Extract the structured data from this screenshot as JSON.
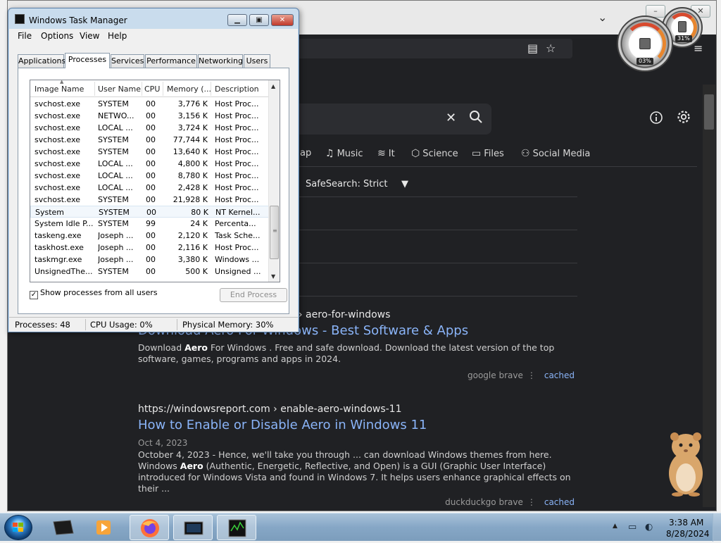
{
  "browser": {
    "search_clear": "✕",
    "categories": [
      {
        "icon": "map-icon",
        "label": "ap"
      },
      {
        "icon": "music-icon",
        "label": "Music"
      },
      {
        "icon": "stack-icon",
        "label": "It"
      },
      {
        "icon": "cube-icon",
        "label": "Science"
      },
      {
        "icon": "files-icon",
        "label": "Files"
      },
      {
        "icon": "people-icon",
        "label": "Social Media"
      }
    ],
    "safesearch": "SafeSearch: Strict",
    "results": [
      {
        "url": "› aero-for-windows",
        "title": "Download Aero For Windows - Best Software & Apps",
        "snippet_pre": "Download ",
        "snippet_bold": "Aero",
        "snippet_post": " For Windows . Free and safe download. Download the latest version of the top software, games, programs and apps in 2024.",
        "sources": "google  brave",
        "cached": "cached"
      },
      {
        "url": "https://windowsreport.com › enable-aero-windows-11",
        "title": "How to Enable or Disable Aero in Windows 11",
        "date": "Oct 4, 2023",
        "snippet_pre": "October 4, 2023 - Hence, we'll take you through ... can download Windows themes from here. Windows ",
        "snippet_bold": "Aero",
        "snippet_post": " (Authentic, Energetic, Reflective, and Open) is a GUI (Graphic User Interface) introduced for Windows Vista and found in Windows 7. It helps users enhance graphical effects on their ...",
        "sources": "duckduckgo  brave",
        "cached": "cached"
      }
    ]
  },
  "taskmgr": {
    "title": "Windows Task Manager",
    "menu": [
      "File",
      "Options",
      "View",
      "Help"
    ],
    "tabs": [
      "Applications",
      "Processes",
      "Services",
      "Performance",
      "Networking",
      "Users"
    ],
    "active_tab": "Processes",
    "columns": [
      "Image Name",
      "User Name",
      "CPU",
      "Memory (...",
      "Description"
    ],
    "rows": [
      {
        "name": "svchost.exe",
        "user": "SYSTEM",
        "cpu": "00",
        "mem": "3,776 K",
        "desc": "Host Proc..."
      },
      {
        "name": "svchost.exe",
        "user": "NETWO...",
        "cpu": "00",
        "mem": "3,156 K",
        "desc": "Host Proc..."
      },
      {
        "name": "svchost.exe",
        "user": "LOCAL ...",
        "cpu": "00",
        "mem": "3,724 K",
        "desc": "Host Proc..."
      },
      {
        "name": "svchost.exe",
        "user": "SYSTEM",
        "cpu": "00",
        "mem": "77,744 K",
        "desc": "Host Proc..."
      },
      {
        "name": "svchost.exe",
        "user": "SYSTEM",
        "cpu": "00",
        "mem": "13,640 K",
        "desc": "Host Proc..."
      },
      {
        "name": "svchost.exe",
        "user": "LOCAL ...",
        "cpu": "00",
        "mem": "4,800 K",
        "desc": "Host Proc..."
      },
      {
        "name": "svchost.exe",
        "user": "LOCAL ...",
        "cpu": "00",
        "mem": "8,780 K",
        "desc": "Host Proc..."
      },
      {
        "name": "svchost.exe",
        "user": "LOCAL ...",
        "cpu": "00",
        "mem": "2,428 K",
        "desc": "Host Proc..."
      },
      {
        "name": "svchost.exe",
        "user": "SYSTEM",
        "cpu": "00",
        "mem": "21,928 K",
        "desc": "Host Proc..."
      },
      {
        "name": "System",
        "user": "SYSTEM",
        "cpu": "00",
        "mem": "80 K",
        "desc": "NT Kernel..."
      },
      {
        "name": "System Idle P...",
        "user": "SYSTEM",
        "cpu": "99",
        "mem": "24 K",
        "desc": "Percenta..."
      },
      {
        "name": "taskeng.exe",
        "user": "Joseph ...",
        "cpu": "00",
        "mem": "2,120 K",
        "desc": "Task Sche..."
      },
      {
        "name": "taskhost.exe",
        "user": "Joseph ...",
        "cpu": "00",
        "mem": "2,116 K",
        "desc": "Host Proc..."
      },
      {
        "name": "taskmgr.exe",
        "user": "Joseph ...",
        "cpu": "00",
        "mem": "3,380 K",
        "desc": "Windows ..."
      },
      {
        "name": "UnsignedThe...",
        "user": "SYSTEM",
        "cpu": "00",
        "mem": "500 K",
        "desc": "Unsigned ..."
      }
    ],
    "selected_row": 9,
    "show_all_label": "Show processes from all users",
    "show_all_checked": "✓",
    "end_process": "End Process",
    "status": {
      "processes": "Processes: 48",
      "cpu": "CPU Usage: 0%",
      "memory": "Physical Memory: 30%"
    }
  },
  "gadgets": {
    "cpu_label": "03%",
    "cpu_percent": 3,
    "mem_label": "31%",
    "mem_percent": 31
  },
  "taskbar": {
    "time": "3:38 AM",
    "date": "8/28/2024"
  },
  "colors": {
    "link": "#8ab4f8",
    "bg_dark": "#202124",
    "gauge_red": "#d84a2e"
  }
}
